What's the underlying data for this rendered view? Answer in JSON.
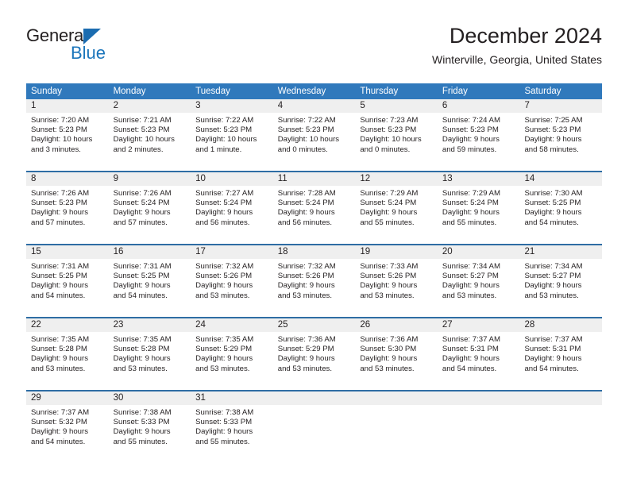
{
  "brand": {
    "name_part1": "General",
    "name_part2": "Blue",
    "triangle_color": "#1b6cb0",
    "blue_color": "#1b75bb"
  },
  "header": {
    "title": "December 2024",
    "subtitle": "Winterville, Georgia, United States"
  },
  "theme": {
    "header_blue": "#3079bc",
    "row_rule_blue": "#2e6da4",
    "daynum_band_gray": "#efefef",
    "text_color": "#231f20"
  },
  "weekdays": [
    "Sunday",
    "Monday",
    "Tuesday",
    "Wednesday",
    "Thursday",
    "Friday",
    "Saturday"
  ],
  "weeks": [
    {
      "days": [
        {
          "num": "1",
          "sunrise": "Sunrise: 7:20 AM",
          "sunset": "Sunset: 5:23 PM",
          "daylight1": "Daylight: 10 hours",
          "daylight2": "and 3 minutes."
        },
        {
          "num": "2",
          "sunrise": "Sunrise: 7:21 AM",
          "sunset": "Sunset: 5:23 PM",
          "daylight1": "Daylight: 10 hours",
          "daylight2": "and 2 minutes."
        },
        {
          "num": "3",
          "sunrise": "Sunrise: 7:22 AM",
          "sunset": "Sunset: 5:23 PM",
          "daylight1": "Daylight: 10 hours",
          "daylight2": "and 1 minute."
        },
        {
          "num": "4",
          "sunrise": "Sunrise: 7:22 AM",
          "sunset": "Sunset: 5:23 PM",
          "daylight1": "Daylight: 10 hours",
          "daylight2": "and 0 minutes."
        },
        {
          "num": "5",
          "sunrise": "Sunrise: 7:23 AM",
          "sunset": "Sunset: 5:23 PM",
          "daylight1": "Daylight: 10 hours",
          "daylight2": "and 0 minutes."
        },
        {
          "num": "6",
          "sunrise": "Sunrise: 7:24 AM",
          "sunset": "Sunset: 5:23 PM",
          "daylight1": "Daylight: 9 hours",
          "daylight2": "and 59 minutes."
        },
        {
          "num": "7",
          "sunrise": "Sunrise: 7:25 AM",
          "sunset": "Sunset: 5:23 PM",
          "daylight1": "Daylight: 9 hours",
          "daylight2": "and 58 minutes."
        }
      ]
    },
    {
      "days": [
        {
          "num": "8",
          "sunrise": "Sunrise: 7:26 AM",
          "sunset": "Sunset: 5:23 PM",
          "daylight1": "Daylight: 9 hours",
          "daylight2": "and 57 minutes."
        },
        {
          "num": "9",
          "sunrise": "Sunrise: 7:26 AM",
          "sunset": "Sunset: 5:24 PM",
          "daylight1": "Daylight: 9 hours",
          "daylight2": "and 57 minutes."
        },
        {
          "num": "10",
          "sunrise": "Sunrise: 7:27 AM",
          "sunset": "Sunset: 5:24 PM",
          "daylight1": "Daylight: 9 hours",
          "daylight2": "and 56 minutes."
        },
        {
          "num": "11",
          "sunrise": "Sunrise: 7:28 AM",
          "sunset": "Sunset: 5:24 PM",
          "daylight1": "Daylight: 9 hours",
          "daylight2": "and 56 minutes."
        },
        {
          "num": "12",
          "sunrise": "Sunrise: 7:29 AM",
          "sunset": "Sunset: 5:24 PM",
          "daylight1": "Daylight: 9 hours",
          "daylight2": "and 55 minutes."
        },
        {
          "num": "13",
          "sunrise": "Sunrise: 7:29 AM",
          "sunset": "Sunset: 5:24 PM",
          "daylight1": "Daylight: 9 hours",
          "daylight2": "and 55 minutes."
        },
        {
          "num": "14",
          "sunrise": "Sunrise: 7:30 AM",
          "sunset": "Sunset: 5:25 PM",
          "daylight1": "Daylight: 9 hours",
          "daylight2": "and 54 minutes."
        }
      ]
    },
    {
      "days": [
        {
          "num": "15",
          "sunrise": "Sunrise: 7:31 AM",
          "sunset": "Sunset: 5:25 PM",
          "daylight1": "Daylight: 9 hours",
          "daylight2": "and 54 minutes."
        },
        {
          "num": "16",
          "sunrise": "Sunrise: 7:31 AM",
          "sunset": "Sunset: 5:25 PM",
          "daylight1": "Daylight: 9 hours",
          "daylight2": "and 54 minutes."
        },
        {
          "num": "17",
          "sunrise": "Sunrise: 7:32 AM",
          "sunset": "Sunset: 5:26 PM",
          "daylight1": "Daylight: 9 hours",
          "daylight2": "and 53 minutes."
        },
        {
          "num": "18",
          "sunrise": "Sunrise: 7:32 AM",
          "sunset": "Sunset: 5:26 PM",
          "daylight1": "Daylight: 9 hours",
          "daylight2": "and 53 minutes."
        },
        {
          "num": "19",
          "sunrise": "Sunrise: 7:33 AM",
          "sunset": "Sunset: 5:26 PM",
          "daylight1": "Daylight: 9 hours",
          "daylight2": "and 53 minutes."
        },
        {
          "num": "20",
          "sunrise": "Sunrise: 7:34 AM",
          "sunset": "Sunset: 5:27 PM",
          "daylight1": "Daylight: 9 hours",
          "daylight2": "and 53 minutes."
        },
        {
          "num": "21",
          "sunrise": "Sunrise: 7:34 AM",
          "sunset": "Sunset: 5:27 PM",
          "daylight1": "Daylight: 9 hours",
          "daylight2": "and 53 minutes."
        }
      ]
    },
    {
      "days": [
        {
          "num": "22",
          "sunrise": "Sunrise: 7:35 AM",
          "sunset": "Sunset: 5:28 PM",
          "daylight1": "Daylight: 9 hours",
          "daylight2": "and 53 minutes."
        },
        {
          "num": "23",
          "sunrise": "Sunrise: 7:35 AM",
          "sunset": "Sunset: 5:28 PM",
          "daylight1": "Daylight: 9 hours",
          "daylight2": "and 53 minutes."
        },
        {
          "num": "24",
          "sunrise": "Sunrise: 7:35 AM",
          "sunset": "Sunset: 5:29 PM",
          "daylight1": "Daylight: 9 hours",
          "daylight2": "and 53 minutes."
        },
        {
          "num": "25",
          "sunrise": "Sunrise: 7:36 AM",
          "sunset": "Sunset: 5:29 PM",
          "daylight1": "Daylight: 9 hours",
          "daylight2": "and 53 minutes."
        },
        {
          "num": "26",
          "sunrise": "Sunrise: 7:36 AM",
          "sunset": "Sunset: 5:30 PM",
          "daylight1": "Daylight: 9 hours",
          "daylight2": "and 53 minutes."
        },
        {
          "num": "27",
          "sunrise": "Sunrise: 7:37 AM",
          "sunset": "Sunset: 5:31 PM",
          "daylight1": "Daylight: 9 hours",
          "daylight2": "and 54 minutes."
        },
        {
          "num": "28",
          "sunrise": "Sunrise: 7:37 AM",
          "sunset": "Sunset: 5:31 PM",
          "daylight1": "Daylight: 9 hours",
          "daylight2": "and 54 minutes."
        }
      ]
    },
    {
      "days": [
        {
          "num": "29",
          "sunrise": "Sunrise: 7:37 AM",
          "sunset": "Sunset: 5:32 PM",
          "daylight1": "Daylight: 9 hours",
          "daylight2": "and 54 minutes."
        },
        {
          "num": "30",
          "sunrise": "Sunrise: 7:38 AM",
          "sunset": "Sunset: 5:33 PM",
          "daylight1": "Daylight: 9 hours",
          "daylight2": "and 55 minutes."
        },
        {
          "num": "31",
          "sunrise": "Sunrise: 7:38 AM",
          "sunset": "Sunset: 5:33 PM",
          "daylight1": "Daylight: 9 hours",
          "daylight2": "and 55 minutes."
        },
        {
          "num": "",
          "sunrise": "",
          "sunset": "",
          "daylight1": "",
          "daylight2": ""
        },
        {
          "num": "",
          "sunrise": "",
          "sunset": "",
          "daylight1": "",
          "daylight2": ""
        },
        {
          "num": "",
          "sunrise": "",
          "sunset": "",
          "daylight1": "",
          "daylight2": ""
        },
        {
          "num": "",
          "sunrise": "",
          "sunset": "",
          "daylight1": "",
          "daylight2": ""
        }
      ]
    }
  ]
}
